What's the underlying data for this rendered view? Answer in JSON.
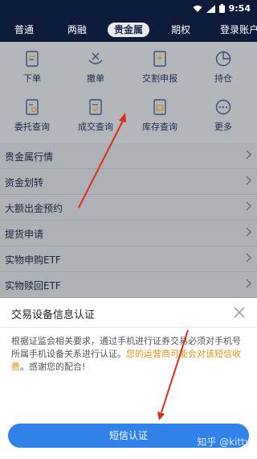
{
  "status_bar": {
    "time": "9:54",
    "icons": [
      "wifi-icon",
      "signal-icon",
      "battery-icon"
    ]
  },
  "tabs": [
    {
      "label": "普通",
      "active": false
    },
    {
      "label": "两融",
      "active": false
    },
    {
      "label": "贵金属",
      "active": true
    },
    {
      "label": "期权",
      "active": false
    },
    {
      "label": "登录账户",
      "active": false
    }
  ],
  "grid": [
    {
      "label": "下单",
      "icon": "order-document-icon"
    },
    {
      "label": "撤单",
      "icon": "cancel-order-icon"
    },
    {
      "label": "交割申报",
      "icon": "delivery-declare-icon"
    },
    {
      "label": "持仓",
      "icon": "position-pie-icon"
    },
    {
      "label": "委托查询",
      "icon": "entrust-query-icon"
    },
    {
      "label": "成交查询",
      "icon": "deal-query-icon"
    },
    {
      "label": "库存查询",
      "icon": "inventory-query-icon"
    },
    {
      "label": "更多",
      "icon": "more-dots-icon"
    }
  ],
  "list_items": [
    {
      "label": "贵金属行情"
    },
    {
      "label": "资金划转"
    },
    {
      "label": "大额出金预约"
    },
    {
      "label": "提货申请"
    },
    {
      "label": "实物申购ETF"
    },
    {
      "label": "实物赎回ETF"
    }
  ],
  "sheet": {
    "title": "交易设备信息认证",
    "body_plain": "根据证监会相关要求，通过手机进行证券交易必须对手机号所属手机设备关系进行认证。",
    "body_highlight": "您的运营商可能会对该短信收费",
    "body_end": "。感谢您的配合!",
    "button_label": "短信认证"
  },
  "watermark": "知乎 @kitty",
  "colors": {
    "header_bg": "#0f1b3b",
    "accent_blue": "#2e82e8",
    "highlight_orange": "#e0930f",
    "arrow_red": "#e02a1a"
  }
}
